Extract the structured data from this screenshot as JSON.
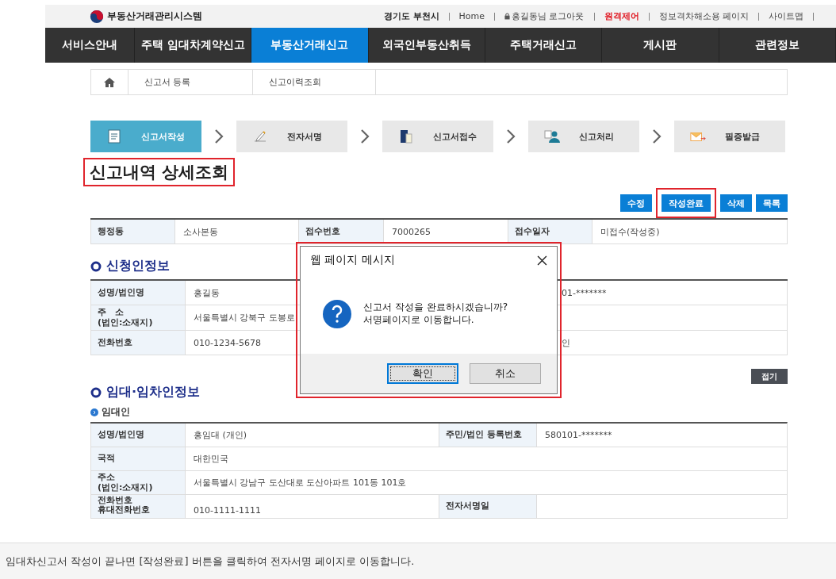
{
  "site": {
    "logo": "부동산거래관리시스템",
    "top_links": [
      {
        "kind": "region",
        "label": "경기도 부천시"
      },
      {
        "kind": "link",
        "label": "Home"
      },
      {
        "kind": "account",
        "label": "홍길동님 로그아웃"
      },
      {
        "kind": "alert",
        "label": "원격제어"
      },
      {
        "kind": "link",
        "label": "정보격차해소용 페이지"
      },
      {
        "kind": "link",
        "label": "사이트맵"
      }
    ],
    "nav": [
      {
        "label": "서비스안내",
        "selected": false
      },
      {
        "label": "주택 임대차계약신고",
        "selected": false
      },
      {
        "label": "부동산거래신고",
        "selected": true
      },
      {
        "label": "외국인부동산취득",
        "selected": false
      },
      {
        "label": "주택거래신고",
        "selected": false
      },
      {
        "label": "게시판",
        "selected": false
      },
      {
        "label": "관련정보",
        "selected": false
      }
    ]
  },
  "breadcrumb": [
    "신고서 등록",
    "신고이력조회"
  ],
  "steps": [
    {
      "label": "신고서작성",
      "selected": true
    },
    {
      "label": "전자서명",
      "selected": false
    },
    {
      "label": "신고서접수",
      "selected": false
    },
    {
      "label": "신고처리",
      "selected": false
    },
    {
      "label": "필증발급",
      "selected": false
    }
  ],
  "page_title": {
    "text": "신고내역 상세조회",
    "highlighted": true
  },
  "actions": [
    {
      "label": "수정",
      "highlighted": false
    },
    {
      "label": "작성완료",
      "highlighted": true
    },
    {
      "label": "삭제",
      "highlighted": false
    },
    {
      "label": "목록",
      "highlighted": false
    }
  ],
  "summary": [
    {
      "label": "행정동",
      "value": "소사본동"
    },
    {
      "label": "접수번호",
      "value": "7000265"
    },
    {
      "label": "접수일자",
      "value": "미접수(작성중)"
    }
  ],
  "applicant": {
    "heading": "신청인정보",
    "rows": [
      {
        "label": "성명/법인명",
        "value": "홍길동",
        "right": "01-*******"
      },
      {
        "label": "주　소\n(법인:소재지)",
        "value": "서울특별시 강북구 도봉로"
      },
      {
        "label": "전화번호",
        "value": "010-1234-5678",
        "right": "인"
      }
    ]
  },
  "parties": {
    "heading": "임대·임차인정보",
    "collapse_button": "접기",
    "subheading": "임대인",
    "rows": [
      {
        "cells": [
          {
            "kind": "label",
            "text": "성명/법인명"
          },
          {
            "kind": "value",
            "text": "홍임대 (개인)"
          },
          {
            "kind": "label",
            "text": "주민/법인 등록번호"
          },
          {
            "kind": "value",
            "text": "580101-*******"
          }
        ]
      },
      {
        "cells": [
          {
            "kind": "label",
            "text": "국적"
          },
          {
            "kind": "wide",
            "text": "대한민국"
          }
        ]
      },
      {
        "cells": [
          {
            "kind": "label",
            "text": "주소\n(법인:소재지)"
          },
          {
            "kind": "wide",
            "text": "서울특별시 강남구 도산대로 도산아파트 101동 101호"
          }
        ]
      },
      {
        "cells": [
          {
            "kind": "label",
            "text": "전화번호\n휴대전화번호"
          },
          {
            "kind": "value",
            "text": "010-1111-1111"
          },
          {
            "kind": "label",
            "text": "전자서명일"
          },
          {
            "kind": "empty"
          }
        ]
      }
    ]
  },
  "dialog": {
    "title": "웹 페이지 메시지",
    "highlighted": true,
    "message": [
      "신고서 작성을 완료하시겠습니까?",
      "서명페이지로 이동합니다."
    ],
    "buttons": [
      {
        "label": "확인",
        "focused": true
      },
      {
        "label": "취소",
        "focused": false
      }
    ]
  },
  "caption": "임대차신고서 작성이 끝나면 [작성완료] 버튼을 클릭하여 전자서명 페이지로 이동합니다."
}
